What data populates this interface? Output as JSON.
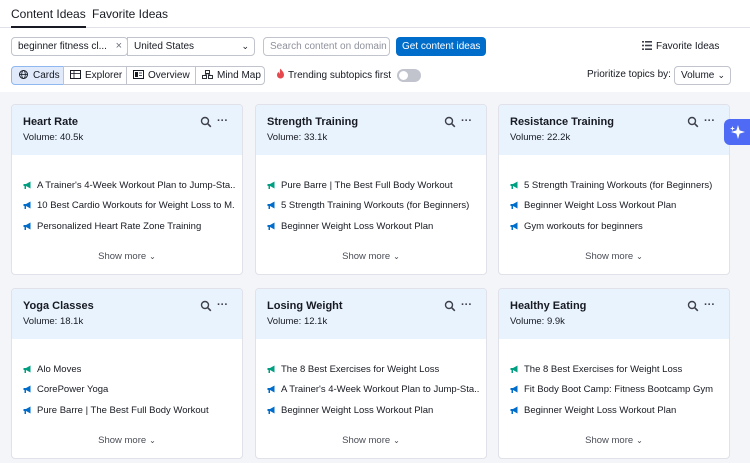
{
  "tabs": [
    {
      "label": "Content Ideas",
      "active": true
    },
    {
      "label": "Favorite Ideas",
      "active": false
    }
  ],
  "toolbar": {
    "topic_value": "beginner fitness cl...",
    "country_value": "United States",
    "search_placeholder": "Search content on domain",
    "get_ideas_label": "Get content ideas",
    "favorite_ideas_label": "Favorite Ideas"
  },
  "views": [
    {
      "label": "Cards",
      "icon": "globe-icon",
      "active": true
    },
    {
      "label": "Explorer",
      "icon": "table-icon",
      "active": false
    },
    {
      "label": "Overview",
      "icon": "overview-icon",
      "active": false
    },
    {
      "label": "Mind Map",
      "icon": "mindmap-icon",
      "active": false
    }
  ],
  "trending": {
    "label": "Trending subtopics first",
    "enabled": false
  },
  "prioritize": {
    "label": "Prioritize topics by:",
    "value": "Volume"
  },
  "cards": [
    {
      "title": "Heart Rate",
      "volume": "Volume: 40.5k",
      "ideas": [
        {
          "text": "A Trainer's 4-Week Workout Plan to Jump-Sta...",
          "icon": "megaphone-icon",
          "color": "#009f81"
        },
        {
          "text": "10 Best Cardio Workouts for Weight Loss to M...",
          "icon": "megaphone-icon",
          "color": "#006dca"
        },
        {
          "text": "Personalized Heart Rate Zone Training",
          "icon": "megaphone-icon",
          "color": "#006dca"
        }
      ],
      "show_more": "Show more"
    },
    {
      "title": "Strength Training",
      "volume": "Volume: 33.1k",
      "ideas": [
        {
          "text": "Pure Barre | The Best Full Body Workout",
          "icon": "megaphone-icon",
          "color": "#009f81"
        },
        {
          "text": "5 Strength Training Workouts (for Beginners)",
          "icon": "megaphone-icon",
          "color": "#006dca"
        },
        {
          "text": "Beginner Weight Loss Workout Plan",
          "icon": "megaphone-icon",
          "color": "#006dca"
        }
      ],
      "show_more": "Show more"
    },
    {
      "title": "Resistance Training",
      "volume": "Volume: 22.2k",
      "ideas": [
        {
          "text": "5 Strength Training Workouts (for Beginners)",
          "icon": "megaphone-icon",
          "color": "#009f81"
        },
        {
          "text": "Beginner Weight Loss Workout Plan",
          "icon": "megaphone-icon",
          "color": "#006dca"
        },
        {
          "text": "Gym workouts for beginners",
          "icon": "megaphone-icon",
          "color": "#006dca"
        }
      ],
      "show_more": "Show more"
    },
    {
      "title": "Yoga Classes",
      "volume": "Volume: 18.1k",
      "ideas": [
        {
          "text": "Alo Moves",
          "icon": "megaphone-icon",
          "color": "#009f81"
        },
        {
          "text": "CorePower Yoga",
          "icon": "megaphone-icon",
          "color": "#006dca"
        },
        {
          "text": "Pure Barre | The Best Full Body Workout",
          "icon": "megaphone-icon",
          "color": "#006dca"
        }
      ],
      "show_more": "Show more"
    },
    {
      "title": "Losing Weight",
      "volume": "Volume: 12.1k",
      "ideas": [
        {
          "text": "The 8 Best Exercises for Weight Loss",
          "icon": "megaphone-icon",
          "color": "#009f81"
        },
        {
          "text": "A Trainer's 4-Week Workout Plan to Jump-Sta...",
          "icon": "megaphone-icon",
          "color": "#006dca"
        },
        {
          "text": "Beginner Weight Loss Workout Plan",
          "icon": "megaphone-icon",
          "color": "#006dca"
        }
      ],
      "show_more": "Show more"
    },
    {
      "title": "Healthy Eating",
      "volume": "Volume: 9.9k",
      "ideas": [
        {
          "text": "The 8 Best Exercises for Weight Loss",
          "icon": "megaphone-icon",
          "color": "#009f81"
        },
        {
          "text": "Fit Body Boot Camp: Fitness Bootcamp Gym",
          "icon": "megaphone-icon",
          "color": "#006dca"
        },
        {
          "text": "Beginner Weight Loss Workout Plan",
          "icon": "megaphone-icon",
          "color": "#006dca"
        }
      ],
      "show_more": "Show more"
    }
  ],
  "colors": {
    "accent": "#006dca",
    "card_header": "#e9f3fd",
    "ai_button": "#4f6af5"
  }
}
